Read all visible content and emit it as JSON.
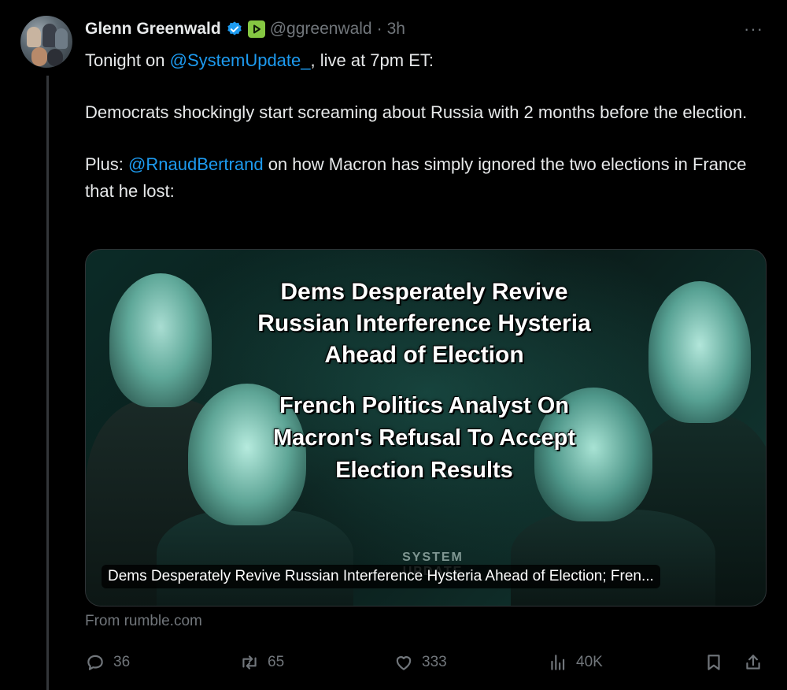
{
  "tweet": {
    "author_name": "Glenn Greenwald",
    "handle": "@ggreenwald",
    "separator": "·",
    "time": "3h",
    "more": "···",
    "lines": {
      "l1_prefix": "Tonight on ",
      "l1_mention": "@SystemUpdate_",
      "l1_suffix": ", live at 7pm ET:",
      "l2": "Democrats shockingly start screaming about Russia with 2 months before the election.",
      "l3_prefix": "Plus: ",
      "l3_mention": "@RnaudBertrand",
      "l3_suffix": " on how Macron has simply ignored the two elections in France that he lost:"
    },
    "accent_color": "#1d9bf0"
  },
  "card": {
    "headline_1": "Dems Desperately Revive Russian Interference Hysteria Ahead of Election",
    "headline_2": "French Politics Analyst On Macron's Refusal To Accept Election Results",
    "watermark": "SYSTEM UPDATE",
    "caption": "Dems Desperately Revive Russian Interference Hysteria Ahead of Election; Fren...",
    "source": "From rumble.com"
  },
  "actions": {
    "replies": "36",
    "reposts": "65",
    "likes": "333",
    "views": "40K"
  },
  "icons": [
    "verified-badge-icon",
    "rumble-badge-icon",
    "more-icon",
    "reply-icon",
    "repost-icon",
    "like-icon",
    "views-icon",
    "bookmark-icon",
    "share-icon"
  ]
}
